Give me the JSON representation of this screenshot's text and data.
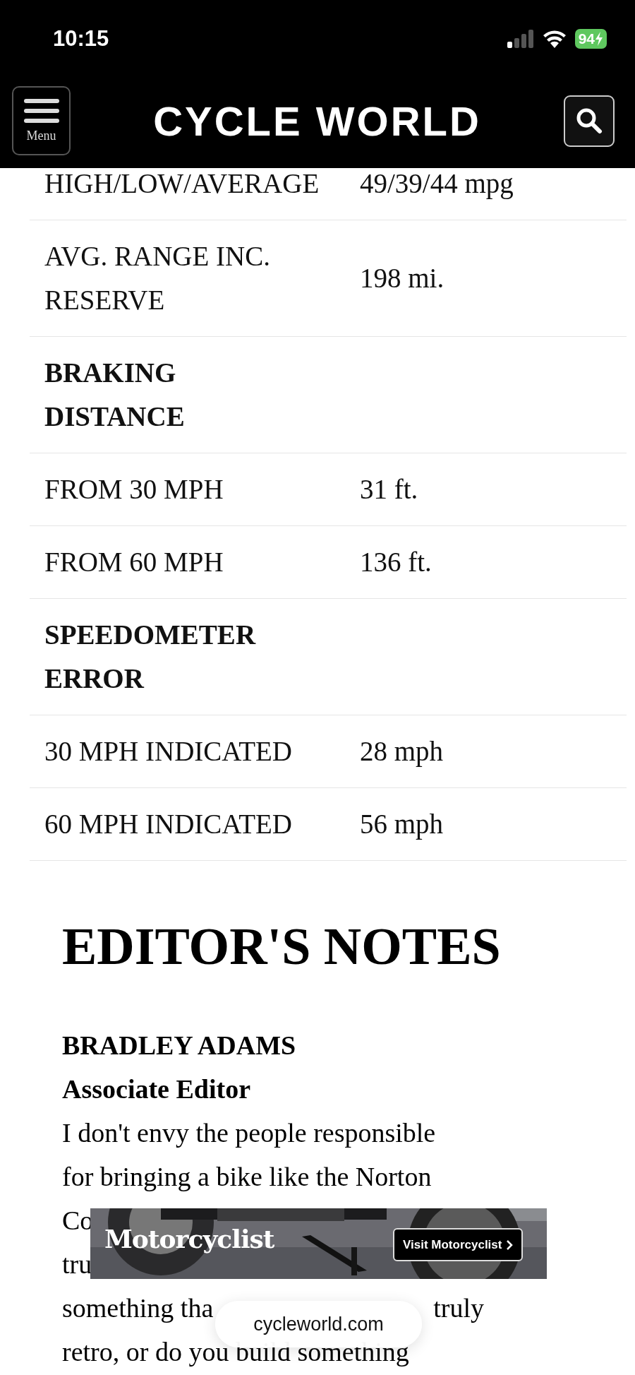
{
  "status_bar": {
    "time": "10:15",
    "battery": "94"
  },
  "header": {
    "menu_label": "Menu",
    "logo": "CYCLE WORLD"
  },
  "spec_table": {
    "rows": [
      {
        "kind": "spec",
        "label": "HIGH/LOW/AVERAGE",
        "value": "49/39/44 mpg"
      },
      {
        "kind": "spec",
        "label": "AVG. RANGE INC. RESERVE",
        "value": "198 mi."
      },
      {
        "kind": "section",
        "label": "BRAKING DISTANCE"
      },
      {
        "kind": "spec",
        "label": "FROM 30 MPH",
        "value": "31 ft."
      },
      {
        "kind": "spec",
        "label": "FROM 60 MPH",
        "value": "136 ft."
      },
      {
        "kind": "section",
        "label": "SPEEDOMETER ERROR"
      },
      {
        "kind": "spec",
        "label": "30 MPH INDICATED",
        "value": "28 mph"
      },
      {
        "kind": "spec",
        "label": "60 MPH INDICATED",
        "value": "56 mph"
      }
    ]
  },
  "editors_notes": {
    "heading": "EDITOR'S NOTES",
    "author": "BRADLEY ADAMS",
    "role": "Associate Editor",
    "body_lines": [
      [
        "I don't envy the people responsible"
      ],
      [
        "for bringing a bike like the Norton"
      ],
      [
        "Co"
      ],
      [
        "tru"
      ],
      [
        "something tha",
        "truly"
      ],
      [
        "retro, or do you build something"
      ]
    ]
  },
  "ad_banner": {
    "logo": "Motorcyclist",
    "button": "Visit Motorcyclist"
  },
  "url_bar": {
    "url": "cycleworld.com"
  }
}
